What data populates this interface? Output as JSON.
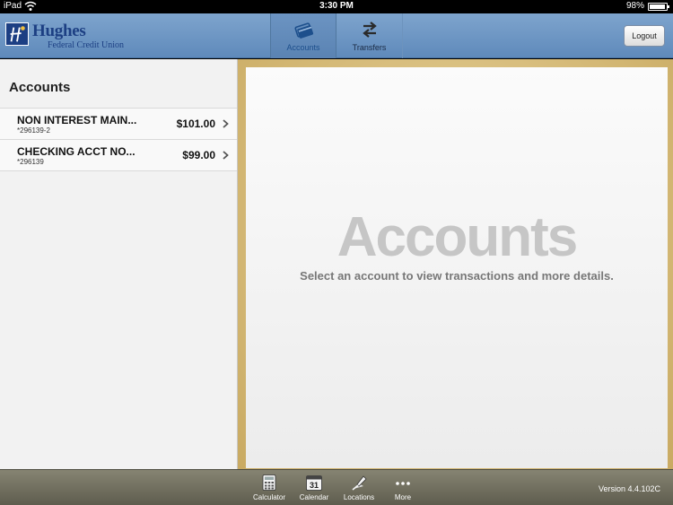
{
  "status_bar": {
    "carrier": "iPad",
    "time": "3:30 PM",
    "battery": "98%"
  },
  "header": {
    "logo_name": "Hughes",
    "logo_subtitle": "Federal Credit Union",
    "tabs": [
      {
        "label": "Accounts",
        "icon": "credit-card-icon",
        "selected": true
      },
      {
        "label": "Transfers",
        "icon": "transfer-arrows-icon",
        "selected": false
      }
    ],
    "logout_label": "Logout"
  },
  "sidebar": {
    "title": "Accounts",
    "accounts": [
      {
        "name": "NON INTEREST MAIN...",
        "number": "*296139-2",
        "balance": "$101.00"
      },
      {
        "name": "CHECKING ACCT NO...",
        "number": "*296139",
        "balance": "$99.00"
      }
    ]
  },
  "main": {
    "title": "Accounts",
    "subtitle": "Select an account to view transactions and more details."
  },
  "bottom_bar": {
    "tools": [
      {
        "label": "Calculator",
        "icon": "calculator-icon"
      },
      {
        "label": "Calendar",
        "icon": "calendar-icon",
        "icon_text": "31"
      },
      {
        "label": "Locations",
        "icon": "map-pin-icon"
      },
      {
        "label": "More",
        "icon": "more-dots-icon"
      }
    ],
    "version": "Version 4.4.102C"
  },
  "colors": {
    "header_blue": "#6f97c5",
    "brand_navy": "#1c3f83",
    "bottom_bar": "#75735f",
    "frame_gold": "#d8be7c"
  }
}
